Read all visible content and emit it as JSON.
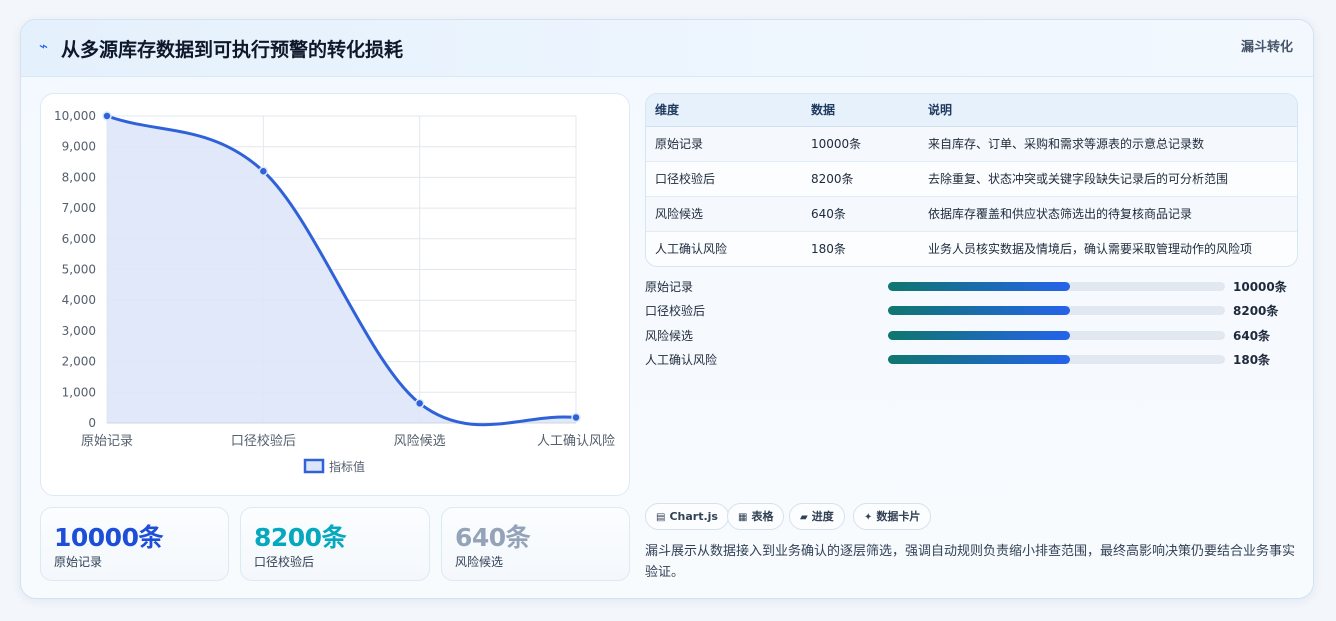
{
  "header": {
    "title": "从多源库存数据到可执行预警的转化损耗",
    "tag": "漏斗转化",
    "icon": "lightning-icon"
  },
  "chart_data": {
    "type": "area",
    "categories": [
      "原始记录",
      "口径校验后",
      "风险候选",
      "人工确认风险"
    ],
    "series": [
      {
        "name": "指标值",
        "values": [
          10000,
          8200,
          640,
          180
        ]
      }
    ],
    "ylim": [
      0,
      10000
    ],
    "yticks": [
      "0",
      "1,000",
      "2,000",
      "3,000",
      "4,000",
      "5,000",
      "6,000",
      "7,000",
      "8,000",
      "9,000",
      "10,000"
    ],
    "grid": true,
    "legend_position": "bottom",
    "line_color": "#2f62d9",
    "fill_color": "#dde6f8"
  },
  "stats": [
    {
      "value": "10000条",
      "label": "原始记录",
      "color": "#1d4ed8"
    },
    {
      "value": "8200条",
      "label": "口径校验后",
      "color": "#06a8bf"
    },
    {
      "value": "640条",
      "label": "风险候选",
      "color": "#94a3b8"
    }
  ],
  "table": {
    "headers": [
      "维度",
      "数据",
      "说明"
    ],
    "rows": [
      [
        "原始记录",
        "10000条",
        "来自库存、订单、采购和需求等源表的示意总记录数"
      ],
      [
        "口径校验后",
        "8200条",
        "去除重复、状态冲突或关键字段缺失记录后的可分析范围"
      ],
      [
        "风险候选",
        "640条",
        "依据库存覆盖和供应状态筛选出的待复核商品记录"
      ],
      [
        "人工确认风险",
        "180条",
        "业务人员核实数据及情境后，确认需要采取管理动作的风险项"
      ]
    ]
  },
  "progress": [
    {
      "label": "原始记录",
      "value": "10000条",
      "fraction": 0.54
    },
    {
      "label": "口径校验后",
      "value": "8200条",
      "fraction": 0.54
    },
    {
      "label": "风险候选",
      "value": "640条",
      "fraction": 0.54
    },
    {
      "label": "人工确认风险",
      "value": "180条",
      "fraction": 0.54
    }
  ],
  "chips": [
    {
      "icon": "▤",
      "label": "Chart.js"
    },
    {
      "icon": "▦",
      "label": "表格"
    },
    {
      "icon": "▰",
      "label": "进度"
    },
    {
      "icon": "✦",
      "label": "数据卡片"
    }
  ],
  "description": "漏斗展示从数据接入到业务确认的逐层筛选，强调自动规则负责缩小排查范围，最终高影响决策仍要结合业务事实验证。"
}
